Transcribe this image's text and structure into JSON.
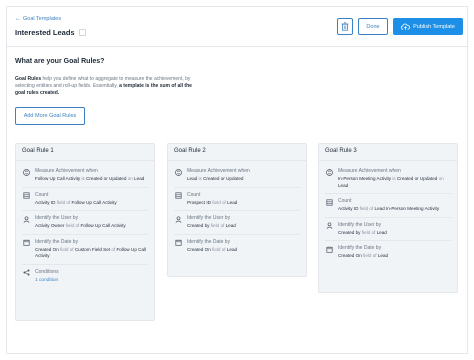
{
  "header": {
    "back_label": "Goal Templates",
    "template_name": "Interested Leads",
    "done_label": "Done",
    "publish_label": "Publish Template"
  },
  "section": {
    "heading": "What are your Goal Rules?",
    "desc_lead": "Goal Rules",
    "desc_mid": " help you define what to aggregate to measure the achievement, by selecting entities and roll-up fields. Essentially, ",
    "desc_bold": "a template is the sum of all the goal rules created.",
    "add_button": "Add More Goal Rules"
  },
  "rules": [
    {
      "title": "Goal Rule 1",
      "measure_title": "Measure Achievement when",
      "measure_a": "Follow Up Call Activity",
      "measure_is": " is ",
      "measure_b": "Created or Updated",
      "measure_on": " on ",
      "measure_c": "Lead",
      "count_title": "Count",
      "count_a": "Activity ID",
      "count_field_of": " field of ",
      "count_b": "Follow Up Call Activity",
      "user_title": "Identify the User by",
      "user_a": "Activity Owner",
      "user_field_of": " field of ",
      "user_b": "Follow Up Call Activity",
      "date_title": "Identify the Date by",
      "date_a": "Created On",
      "date_field_of": " field of ",
      "date_b": "Custom Field Set",
      "date_of": " of ",
      "date_c": "Follow Up Call Activity",
      "conditions_title": "Conditions",
      "conditions_link": "1 condition"
    },
    {
      "title": "Goal Rule 2",
      "measure_title": "Measure Achievement when",
      "measure_a": "Lead",
      "measure_is": " is ",
      "measure_b": "Created or Updated",
      "count_title": "Count",
      "count_a": "Prospect ID",
      "count_field_of": " field of ",
      "count_b": "Lead",
      "user_title": "Identify the User by",
      "user_a": "Created by",
      "user_field_of": " field of ",
      "user_b": "Lead",
      "date_title": "Identify the Date by",
      "date_a": "Created On",
      "date_field_of": " field of ",
      "date_b": "Lead"
    },
    {
      "title": "Goal Rule 3",
      "measure_title": "Measure Achievement when",
      "measure_a": "In-Person Meeting Activity",
      "measure_is": " is ",
      "measure_b": "Created or Updated",
      "measure_on": " on ",
      "measure_c": "Lead",
      "count_title": "Count",
      "count_a": "Activity ID",
      "count_field_of": " field of ",
      "count_b": "Lead In-Person Meeting Activity",
      "user_title": "Identify the User by",
      "user_a": "Created by",
      "user_field_of": " field of ",
      "user_b": "Lead",
      "date_title": "Identify the Date by",
      "date_a": "Created On",
      "date_field_of": " field of ",
      "date_b": "Lead"
    }
  ],
  "colors": {
    "accent": "#1e8fe6",
    "link": "#3b82c4",
    "card_bg": "#f1f4f7"
  }
}
